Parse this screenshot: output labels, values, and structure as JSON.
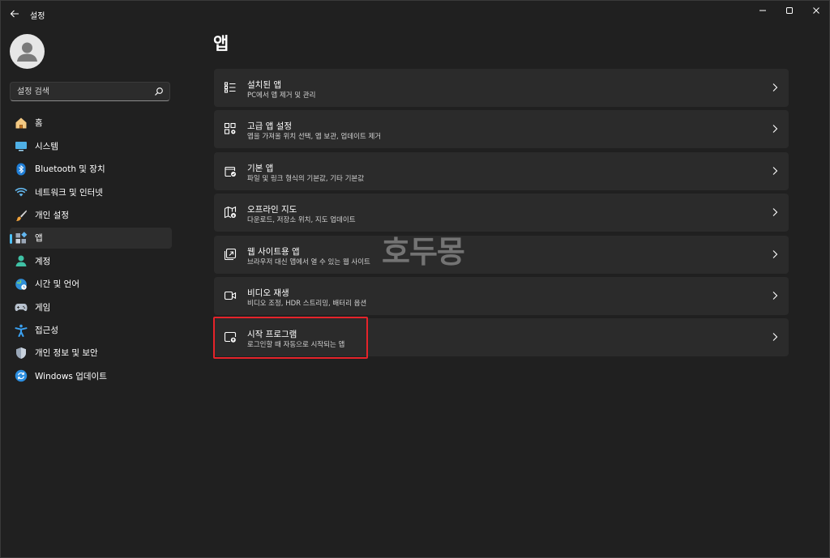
{
  "window": {
    "title": "설정"
  },
  "search": {
    "placeholder": "설정 검색"
  },
  "nav": {
    "items": [
      {
        "label": "홈",
        "icon": "home-icon"
      },
      {
        "label": "시스템",
        "icon": "system-icon"
      },
      {
        "label": "Bluetooth 및 장치",
        "icon": "bluetooth-icon"
      },
      {
        "label": "네트워크 및 인터넷",
        "icon": "wifi-icon"
      },
      {
        "label": "개인 설정",
        "icon": "brush-icon"
      },
      {
        "label": "앱",
        "icon": "apps-icon",
        "active": true
      },
      {
        "label": "계정",
        "icon": "account-icon"
      },
      {
        "label": "시간 및 언어",
        "icon": "time-language-icon"
      },
      {
        "label": "게임",
        "icon": "gamepad-icon"
      },
      {
        "label": "접근성",
        "icon": "accessibility-icon"
      },
      {
        "label": "개인 정보 및 보안",
        "icon": "shield-icon"
      },
      {
        "label": "Windows 업데이트",
        "icon": "update-icon"
      }
    ]
  },
  "main": {
    "title": "앱",
    "cards": [
      {
        "title": "설치된 앱",
        "desc": "PC에서 앱 제거 및 관리",
        "icon": "installed-apps-icon"
      },
      {
        "title": "고급 앱 설정",
        "desc": "앱을 가져올 위치 선택, 앱 보관, 업데이트 제거",
        "icon": "advanced-apps-icon"
      },
      {
        "title": "기본 앱",
        "desc": "파일 및 링크 형식의 기본값, 기타 기본값",
        "icon": "default-apps-icon"
      },
      {
        "title": "오프라인 지도",
        "desc": "다운로드, 저장소 위치, 지도 업데이트",
        "icon": "offline-maps-icon"
      },
      {
        "title": "웹 사이트용 앱",
        "desc": "브라우저 대신 앱에서 열 수 있는 웹 사이트",
        "icon": "web-apps-icon"
      },
      {
        "title": "비디오 재생",
        "desc": "비디오 조정, HDR 스트리밍, 배터리 옵션",
        "icon": "video-icon"
      },
      {
        "title": "시작 프로그램",
        "desc": "로그인할 때 자동으로 시작되는 앱",
        "icon": "startup-icon"
      }
    ]
  },
  "watermark": "호두몽",
  "colors": {
    "accent": "#4cc2ff",
    "highlight": "#e5232a",
    "background": "#202020",
    "card": "#2b2b2b"
  }
}
